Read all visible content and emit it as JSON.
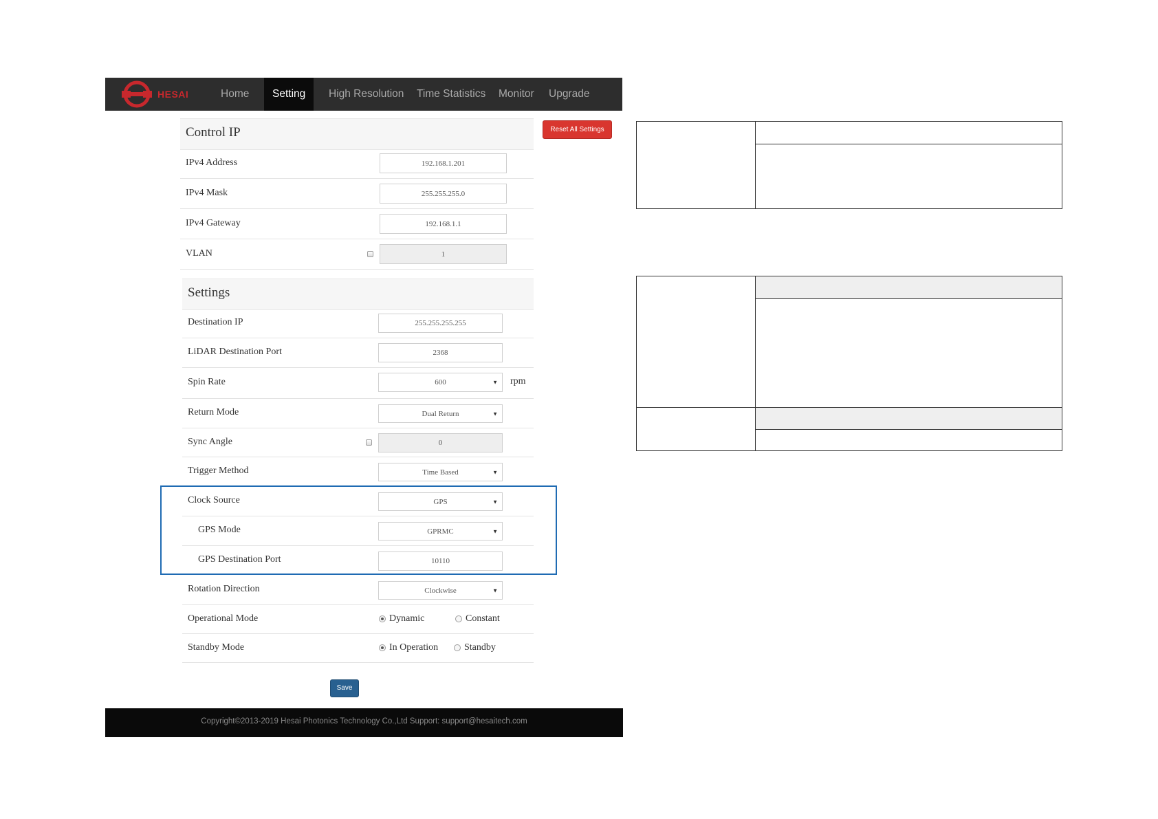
{
  "brand": {
    "logo_text": "HESAI"
  },
  "nav": {
    "items": [
      {
        "label": "Home"
      },
      {
        "label": "Setting"
      },
      {
        "label": "High Resolution"
      },
      {
        "label": "Time Statistics"
      },
      {
        "label": "Monitor"
      },
      {
        "label": "Upgrade"
      }
    ],
    "active": "Setting"
  },
  "reset_button": "Reset All Settings",
  "control_ip": {
    "title": "Control IP",
    "rows": [
      {
        "label": "IPv4 Address",
        "value": "192.168.1.201"
      },
      {
        "label": "IPv4 Mask",
        "value": "255.255.255.0"
      },
      {
        "label": "IPv4 Gateway",
        "value": "192.168.1.1"
      },
      {
        "label": "VLAN",
        "value": "1"
      }
    ]
  },
  "settings": {
    "title": "Settings",
    "rows": [
      {
        "label": "Destination IP",
        "value": "255.255.255.255"
      },
      {
        "label": "LiDAR Destination Port",
        "value": "2368"
      },
      {
        "label": "Spin Rate",
        "value": "600",
        "unit": "rpm"
      },
      {
        "label": "Return Mode",
        "value": "Dual Return"
      },
      {
        "label": "Sync Angle",
        "value": "0"
      },
      {
        "label": "Trigger Method",
        "value": "Time Based"
      },
      {
        "label": "Clock Source",
        "value": "GPS"
      },
      {
        "label": "GPS Mode",
        "value": "GPRMC"
      },
      {
        "label": "GPS Destination Port",
        "value": "10110"
      },
      {
        "label": "Rotation Direction",
        "value": "Clockwise"
      },
      {
        "label": "Operational Mode",
        "options": [
          "Dynamic",
          "Constant"
        ],
        "selected": "Dynamic"
      },
      {
        "label": "Standby Mode",
        "options": [
          "In Operation",
          "Standby"
        ],
        "selected": "In Operation"
      }
    ]
  },
  "save_button": "Save",
  "footer": {
    "text": "Copyright©2013-2019 Hesai Photonics Technology Co.,Ltd Support: support@hesaitech.com"
  },
  "colors": {
    "nav_bg": "#2d2d2d",
    "nav_active_bg": "#0b0b0b",
    "reset_red": "#d9362f",
    "save_blue": "#286090",
    "highlight_blue": "#1f6bb3"
  },
  "icons": {
    "caret": "caret-down-icon",
    "logo": "hesai-logo-icon"
  }
}
